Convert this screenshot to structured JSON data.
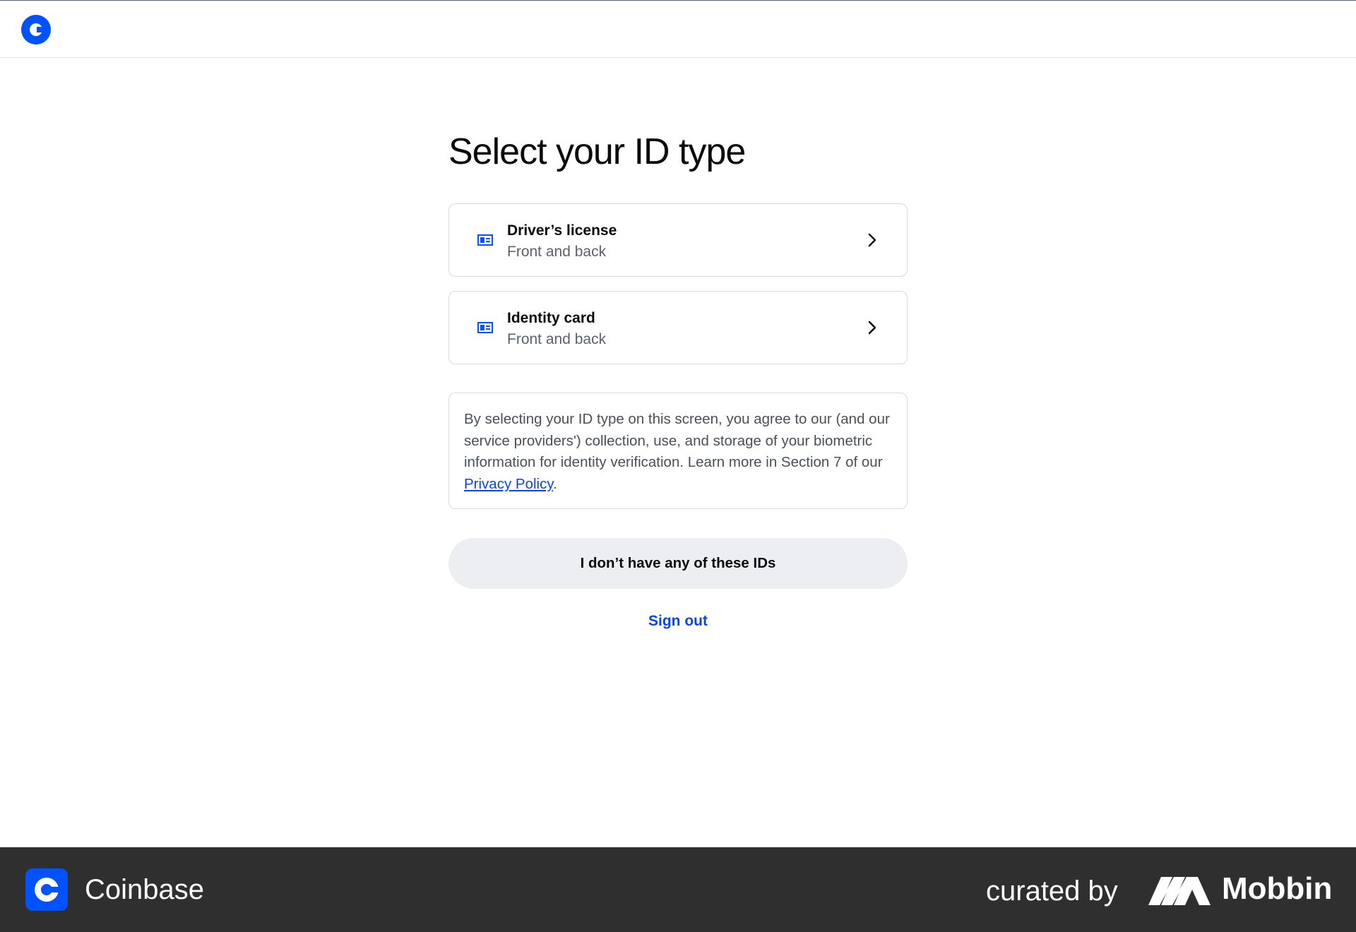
{
  "header": {
    "logo_icon": "coinbase-logo-icon"
  },
  "main": {
    "title": "Select your ID type",
    "options": [
      {
        "title": "Driver’s license",
        "subtitle": "Front and back",
        "icon": "id-card-icon"
      },
      {
        "title": "Identity card",
        "subtitle": "Front and back",
        "icon": "id-card-icon"
      }
    ],
    "notice": {
      "text": "By selecting your ID type on this screen, you agree to our (and our service providers') collection, use, and storage of your biometric information for identity verification. Learn more in Section 7 of our ",
      "link": "Privacy Policy",
      "end": "."
    },
    "no_ids_button": "I don’t have any of these IDs",
    "sign_out": "Sign out"
  },
  "footer": {
    "brand": "Coinbase",
    "curated_by": "curated by",
    "curator": "Mobbin"
  },
  "colors": {
    "accent": "#0052ff",
    "link": "#0a46e4",
    "footer_bg": "#2f2f30",
    "button_bg": "#eceef1"
  }
}
